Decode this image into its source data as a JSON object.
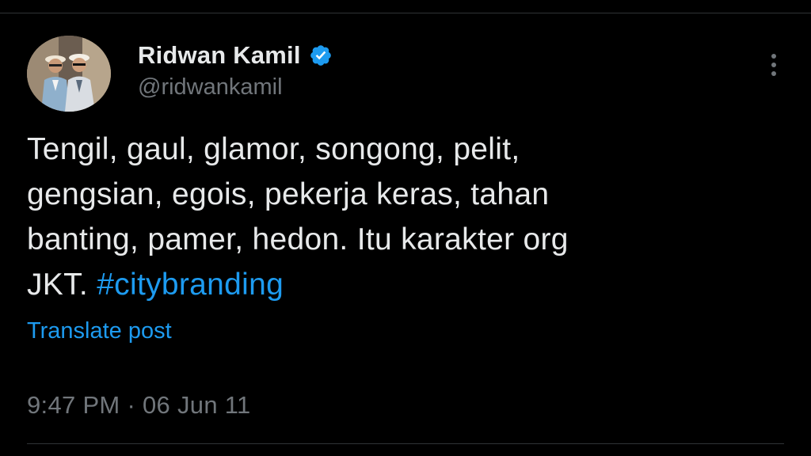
{
  "author": {
    "display_name": "Ridwan Kamil",
    "handle": "@ridwankamil",
    "verified": true,
    "avatar_icon": "profile-photo"
  },
  "tweet": {
    "lines": [
      "Tengil, gaul, glamor, songong, pelit,",
      "gengsian, egois, pekerja keras, tahan",
      "banting, pamer, hedon. Itu karakter org"
    ],
    "last_line_text": "JKT. ",
    "hashtag": "#citybranding"
  },
  "translate_label": "Translate post",
  "meta": {
    "time": "9:47 PM",
    "separator": " · ",
    "date": "06 Jun 11"
  },
  "colors": {
    "background": "#000000",
    "text": "#e7e9ea",
    "muted": "#71767b",
    "accent": "#1d9bf0",
    "divider": "#2f3336"
  },
  "icons": {
    "verified": "verified-badge-icon",
    "more": "more-options-icon"
  }
}
